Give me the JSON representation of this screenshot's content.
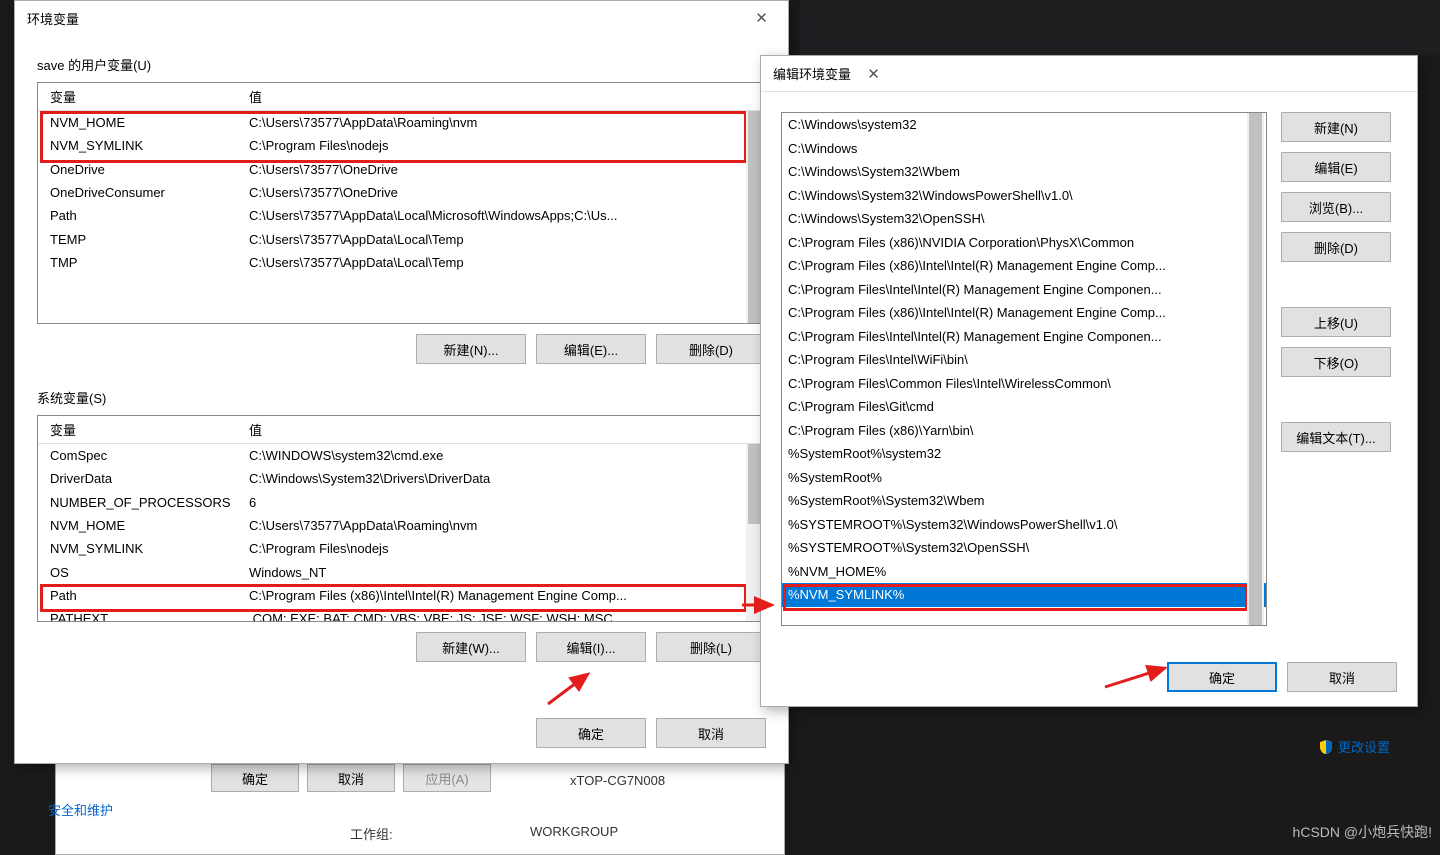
{
  "env_dialog": {
    "title": "环境变量",
    "user_section_label": "save 的用户变量(U)",
    "system_section_label": "系统变量(S)",
    "columns": {
      "variable": "变量",
      "value": "值"
    },
    "user_vars": [
      {
        "name": "NVM_HOME",
        "value": "C:\\Users\\73577\\AppData\\Roaming\\nvm"
      },
      {
        "name": "NVM_SYMLINK",
        "value": "C:\\Program Files\\nodejs"
      },
      {
        "name": "OneDrive",
        "value": "C:\\Users\\73577\\OneDrive"
      },
      {
        "name": "OneDriveConsumer",
        "value": "C:\\Users\\73577\\OneDrive"
      },
      {
        "name": "Path",
        "value": "C:\\Users\\73577\\AppData\\Local\\Microsoft\\WindowsApps;C:\\Us..."
      },
      {
        "name": "TEMP",
        "value": "C:\\Users\\73577\\AppData\\Local\\Temp"
      },
      {
        "name": "TMP",
        "value": "C:\\Users\\73577\\AppData\\Local\\Temp"
      }
    ],
    "system_vars": [
      {
        "name": "ComSpec",
        "value": "C:\\WINDOWS\\system32\\cmd.exe"
      },
      {
        "name": "DriverData",
        "value": "C:\\Windows\\System32\\Drivers\\DriverData"
      },
      {
        "name": "NUMBER_OF_PROCESSORS",
        "value": "6"
      },
      {
        "name": "NVM_HOME",
        "value": "C:\\Users\\73577\\AppData\\Roaming\\nvm"
      },
      {
        "name": "NVM_SYMLINK",
        "value": "C:\\Program Files\\nodejs"
      },
      {
        "name": "OS",
        "value": "Windows_NT"
      },
      {
        "name": "Path",
        "value": "C:\\Program Files (x86)\\Intel\\Intel(R) Management Engine Comp..."
      },
      {
        "name": "PATHEXT",
        "value": ".COM;.EXE;.BAT;.CMD;.VBS;.VBE;.JS;.JSE;.WSF;.WSH;.MSC"
      }
    ],
    "buttons_user": {
      "new": "新建(N)...",
      "edit": "编辑(E)...",
      "delete": "删除(D)"
    },
    "buttons_sys": {
      "new": "新建(W)...",
      "edit": "编辑(I)...",
      "delete": "删除(L)"
    },
    "ok": "确定",
    "cancel": "取消"
  },
  "edit_dialog": {
    "title": "编辑环境变量",
    "paths": [
      "C:\\Windows\\system32",
      "C:\\Windows",
      "C:\\Windows\\System32\\Wbem",
      "C:\\Windows\\System32\\WindowsPowerShell\\v1.0\\",
      "C:\\Windows\\System32\\OpenSSH\\",
      "C:\\Program Files (x86)\\NVIDIA Corporation\\PhysX\\Common",
      "C:\\Program Files (x86)\\Intel\\Intel(R) Management Engine Comp...",
      "C:\\Program Files\\Intel\\Intel(R) Management Engine Componen...",
      "C:\\Program Files (x86)\\Intel\\Intel(R) Management Engine Comp...",
      "C:\\Program Files\\Intel\\Intel(R) Management Engine Componen...",
      "C:\\Program Files\\Intel\\WiFi\\bin\\",
      "C:\\Program Files\\Common Files\\Intel\\WirelessCommon\\",
      "C:\\Program Files\\Git\\cmd",
      "C:\\Program Files (x86)\\Yarn\\bin\\",
      "%SystemRoot%\\system32",
      "%SystemRoot%",
      "%SystemRoot%\\System32\\Wbem",
      "%SYSTEMROOT%\\System32\\WindowsPowerShell\\v1.0\\",
      "%SYSTEMROOT%\\System32\\OpenSSH\\",
      "%NVM_HOME%",
      "%NVM_SYMLINK%"
    ],
    "selected_index": 20,
    "buttons": {
      "new": "新建(N)",
      "edit": "编辑(E)",
      "browse": "浏览(B)...",
      "delete": "删除(D)",
      "move_up": "上移(U)",
      "move_down": "下移(O)",
      "edit_text": "编辑文本(T)..."
    },
    "ok": "确定",
    "cancel": "取消"
  },
  "under": {
    "security": "安全和维护",
    "workgroup_label": "工作组:",
    "workgroup_value": "WORKGROUP",
    "desktop_fragment": "xTOP-CG7N008",
    "ok": "确定",
    "cancel": "取消",
    "apply": "应用(A)"
  },
  "change_settings": "更改设置",
  "watermark": "hCSDN @小炮兵快跑!"
}
